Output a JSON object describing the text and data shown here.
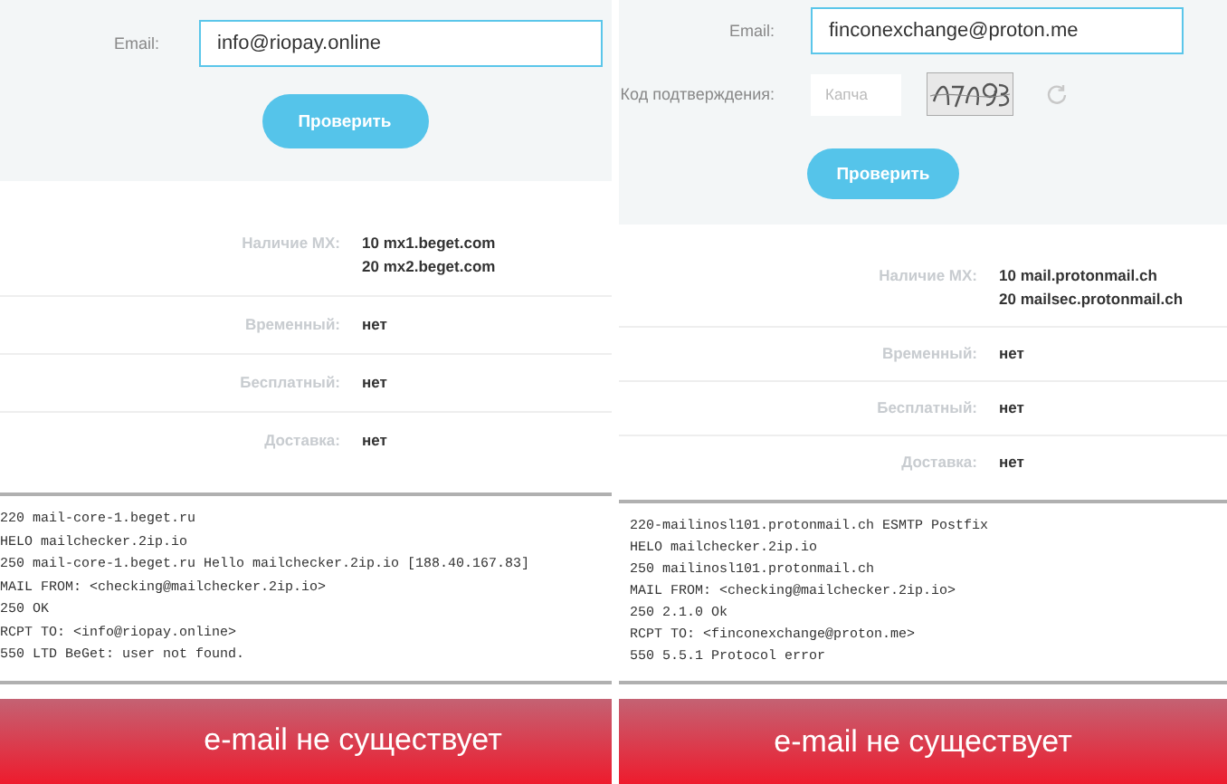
{
  "panels": [
    {
      "email": {
        "label": "Email:",
        "value": "info@riopay.online"
      },
      "button": "Проверить",
      "results": [
        {
          "label": "Наличие MX:",
          "values": [
            "10 mx1.beget.com",
            "20 mx2.beget.com"
          ]
        },
        {
          "label": "Временный:",
          "values": [
            "нет"
          ]
        },
        {
          "label": "Бесплатный:",
          "values": [
            "нет"
          ]
        },
        {
          "label": "Доставка:",
          "values": [
            "нет"
          ]
        }
      ],
      "log": [
        "220 mail-core-1.beget.ru",
        "HELO mailchecker.2ip.io",
        "250 mail-core-1.beget.ru Hello mailchecker.2ip.io [188.40.167.83]",
        "MAIL FROM: <checking@mailchecker.2ip.io>",
        "250 OK",
        "RCPT TO: <info@riopay.online>",
        "550 LTD BeGet: user not found."
      ],
      "verdict": "e-mail не существует"
    },
    {
      "email": {
        "label": "Email:",
        "value": "finconexchange@proton.me"
      },
      "captcha": {
        "label": "Код подтверждения:",
        "placeholder": "Капча"
      },
      "button": "Проверить",
      "results": [
        {
          "label": "Наличие MX:",
          "values": [
            "10 mail.protonmail.ch",
            "20 mailsec.protonmail.ch"
          ]
        },
        {
          "label": "Временный:",
          "values": [
            "нет"
          ]
        },
        {
          "label": "Бесплатный:",
          "values": [
            "нет"
          ]
        },
        {
          "label": "Доставка:",
          "values": [
            "нет"
          ]
        }
      ],
      "log": [
        "220-mailinosl101.protonmail.ch ESMTP Postfix",
        "HELO mailchecker.2ip.io",
        "250 mailinosl101.protonmail.ch",
        "MAIL FROM: <checking@mailchecker.2ip.io>",
        "250 2.1.0 Ok",
        "RCPT TO: <finconexchange@proton.me>",
        "550 5.5.1 Protocol error"
      ],
      "verdict": "e-mail не существует"
    }
  ]
}
